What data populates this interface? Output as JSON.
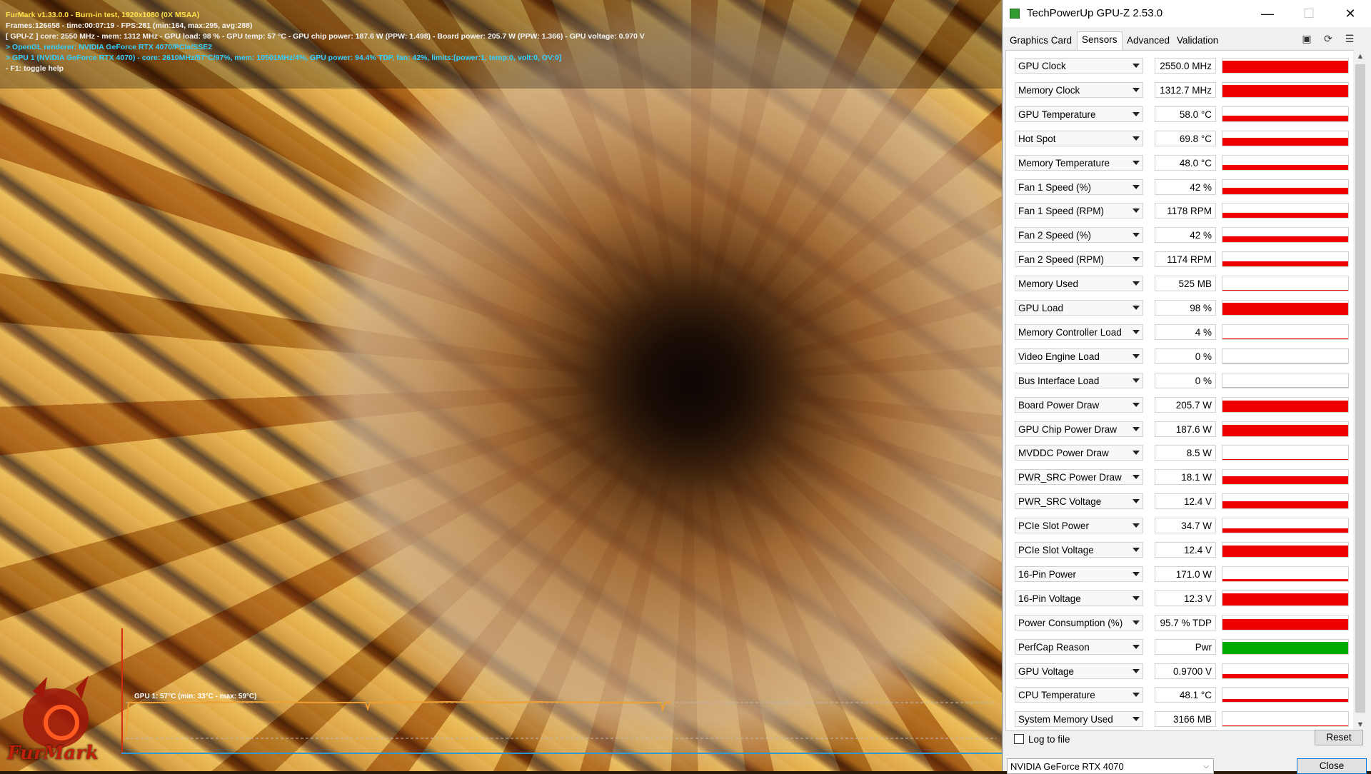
{
  "furmark": {
    "hud": {
      "line1": "FurMark v1.33.0.0 - Burn-in test, 1920x1080 (0X MSAA)",
      "line2": "Frames:126658 - time:00:07:19 - FPS:281 (min:164, max:295, avg:288)",
      "line3": "[ GPU-Z ] core: 2550 MHz - mem: 1312 MHz - GPU load: 98 % - GPU temp: 57 °C - GPU chip power: 187.6 W (PPW: 1.498) - Board power: 205.7 W (PPW: 1.366) - GPU voltage: 0.970 V",
      "line4": "> OpenGL renderer: NVIDIA GeForce RTX 4070/PCIe/SSE2",
      "line5": "> GPU 1 (NVIDIA GeForce RTX 4070) - core: 2610MHz/57°C/97%, mem: 10501MHz/4%, GPU power: 94.4% TDP, fan: 42%, limits:[power:1, temp:0, volt:0, OV:0]",
      "line6": "- F1: toggle help"
    },
    "graph_label": "GPU 1: 57°C (min: 33°C - max: 59°C)",
    "logo_text": "FurMark"
  },
  "gpuz": {
    "title": "TechPowerUp GPU-Z 2.53.0",
    "window_buttons": {
      "minimize": "—",
      "maximize": "☐",
      "close": "✕"
    },
    "tabs": [
      "Graphics Card",
      "Sensors",
      "Advanced",
      "Validation"
    ],
    "active_tab": "Sensors",
    "toolbar_icons": [
      "camera-icon",
      "refresh-icon",
      "menu-icon"
    ],
    "sensors": [
      {
        "name": "GPU Clock",
        "value": "2550.0 MHz",
        "level": 0.85,
        "color": "#ee0000"
      },
      {
        "name": "Memory Clock",
        "value": "1312.7 MHz",
        "level": 0.85,
        "color": "#ee0000"
      },
      {
        "name": "GPU Temperature",
        "value": "58.0 °C",
        "level": 0.4,
        "color": "#ee0000"
      },
      {
        "name": "Hot Spot",
        "value": "69.8 °C",
        "level": 0.55,
        "color": "#ee0000"
      },
      {
        "name": "Memory Temperature",
        "value": "48.0 °C",
        "level": 0.35,
        "color": "#ee0000"
      },
      {
        "name": "Fan 1 Speed (%)",
        "value": "42 %",
        "level": 0.42,
        "color": "#ee0000"
      },
      {
        "name": "Fan 1 Speed (RPM)",
        "value": "1178 RPM",
        "level": 0.35,
        "color": "#ee0000"
      },
      {
        "name": "Fan 2 Speed (%)",
        "value": "42 %",
        "level": 0.42,
        "color": "#ee0000"
      },
      {
        "name": "Fan 2 Speed (RPM)",
        "value": "1174 RPM",
        "level": 0.35,
        "color": "#ee0000"
      },
      {
        "name": "Memory Used",
        "value": "525 MB",
        "level": 0.06,
        "color": "#ee0000"
      },
      {
        "name": "GPU Load",
        "value": "98 %",
        "level": 0.85,
        "color": "#ee0000"
      },
      {
        "name": "Memory Controller Load",
        "value": "4 %",
        "level": 0.04,
        "color": "#ee0000"
      },
      {
        "name": "Video Engine Load",
        "value": "0 %",
        "level": 0.0,
        "color": "#ee0000"
      },
      {
        "name": "Bus Interface Load",
        "value": "0 %",
        "level": 0.0,
        "color": "#ee0000"
      },
      {
        "name": "Board Power Draw",
        "value": "205.7 W",
        "level": 0.8,
        "color": "#ee0000"
      },
      {
        "name": "GPU Chip Power Draw",
        "value": "187.6 W",
        "level": 0.8,
        "color": "#ee0000"
      },
      {
        "name": "MVDDC Power Draw",
        "value": "8.5 W",
        "level": 0.06,
        "color": "#ee0000"
      },
      {
        "name": "PWR_SRC Power Draw",
        "value": "18.1 W",
        "level": 0.55,
        "color": "#ee0000"
      },
      {
        "name": "PWR_SRC Voltage",
        "value": "12.4 V",
        "level": 0.5,
        "color": "#ee0000"
      },
      {
        "name": "PCIe Slot Power",
        "value": "34.7 W",
        "level": 0.3,
        "color": "#ee0000"
      },
      {
        "name": "PCIe Slot Voltage",
        "value": "12.4 V",
        "level": 0.8,
        "color": "#ee0000"
      },
      {
        "name": "16-Pin Power",
        "value": "171.0 W",
        "level": 0.15,
        "color": "#ee0000"
      },
      {
        "name": "16-Pin Voltage",
        "value": "12.3 V",
        "level": 0.85,
        "color": "#ee0000"
      },
      {
        "name": "Power Consumption (%)",
        "value": "95.7 % TDP",
        "level": 0.75,
        "color": "#ee0000"
      },
      {
        "name": "PerfCap Reason",
        "value": "Pwr",
        "level": 0.85,
        "color": "#00aa00"
      },
      {
        "name": "GPU Voltage",
        "value": "0.9700 V",
        "level": 0.3,
        "color": "#ee0000"
      },
      {
        "name": "CPU Temperature",
        "value": "48.1 °C",
        "level": 0.2,
        "color": "#ee0000"
      },
      {
        "name": "System Memory Used",
        "value": "3166 MB",
        "level": 0.08,
        "color": "#ee0000"
      }
    ],
    "log_to_file_label": "Log to file",
    "reset_label": "Reset",
    "gpu_select_value": "NVIDIA GeForce RTX 4070",
    "close_label": "Close"
  }
}
